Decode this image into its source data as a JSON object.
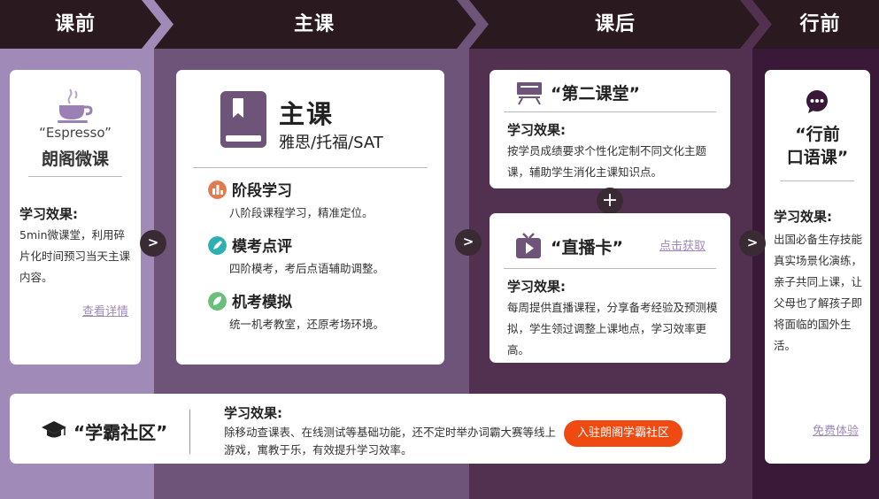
{
  "header": {
    "steps": [
      "课前",
      "主课",
      "课后",
      "行前"
    ]
  },
  "espresso": {
    "subtitle": "“Espresso”",
    "title": "朗阁微课",
    "effect_title": "学习效果:",
    "effect_text": "5min微课堂，利用碎片化时间预习当天主课内容。",
    "link": "查看详情"
  },
  "main": {
    "title": "主课",
    "subtitle": "雅思/托福/SAT",
    "stages": [
      {
        "title": "阶段学习",
        "desc": "八阶段课程学习，精准定位。",
        "color": "#e07b50"
      },
      {
        "title": "模考点评",
        "desc": "四阶模考，考后点语辅助调整。",
        "color": "#2eb0b0"
      },
      {
        "title": "机考模拟",
        "desc": "统一机考教室，还原考场环境。",
        "color": "#6cbf7a"
      }
    ]
  },
  "second_class": {
    "title": "“第二课堂”",
    "effect_title": "学习效果:",
    "effect_text": "按学员成绩要求个性化定制不同文化主题课，辅助学生消化主课知识点。"
  },
  "live": {
    "title": "“直播卡”",
    "link": "点击获取",
    "effect_title": "学习效果:",
    "effect_text": "每周提供直播课程，分享备考经验及预测模拟，学生领过调整上课地点，学习效率更高。"
  },
  "abroad": {
    "title_line1": "“行前",
    "title_line2": "口语课”",
    "effect_title": "学习效果:",
    "effect_text": "出国必备生存技能真实场景化演练，亲子共同上课，让父母也了解孩子即将面临的国外生活。",
    "link": "免费体验"
  },
  "community": {
    "title": "“学霸社区”",
    "effect_title": "学习效果:",
    "effect_text": "除移动查课表、在线测试等基础功能，还不定时举办词霸大赛等线上游戏，寓教于乐，有效提升学习效率。",
    "button": "入驻朗阁学霸社区"
  },
  "nav": {
    "arrow": ">",
    "plus": "+"
  },
  "colors": {
    "accent": "#ee4a12",
    "icon_purple": "#6e5478",
    "link": "#a08ab8"
  }
}
